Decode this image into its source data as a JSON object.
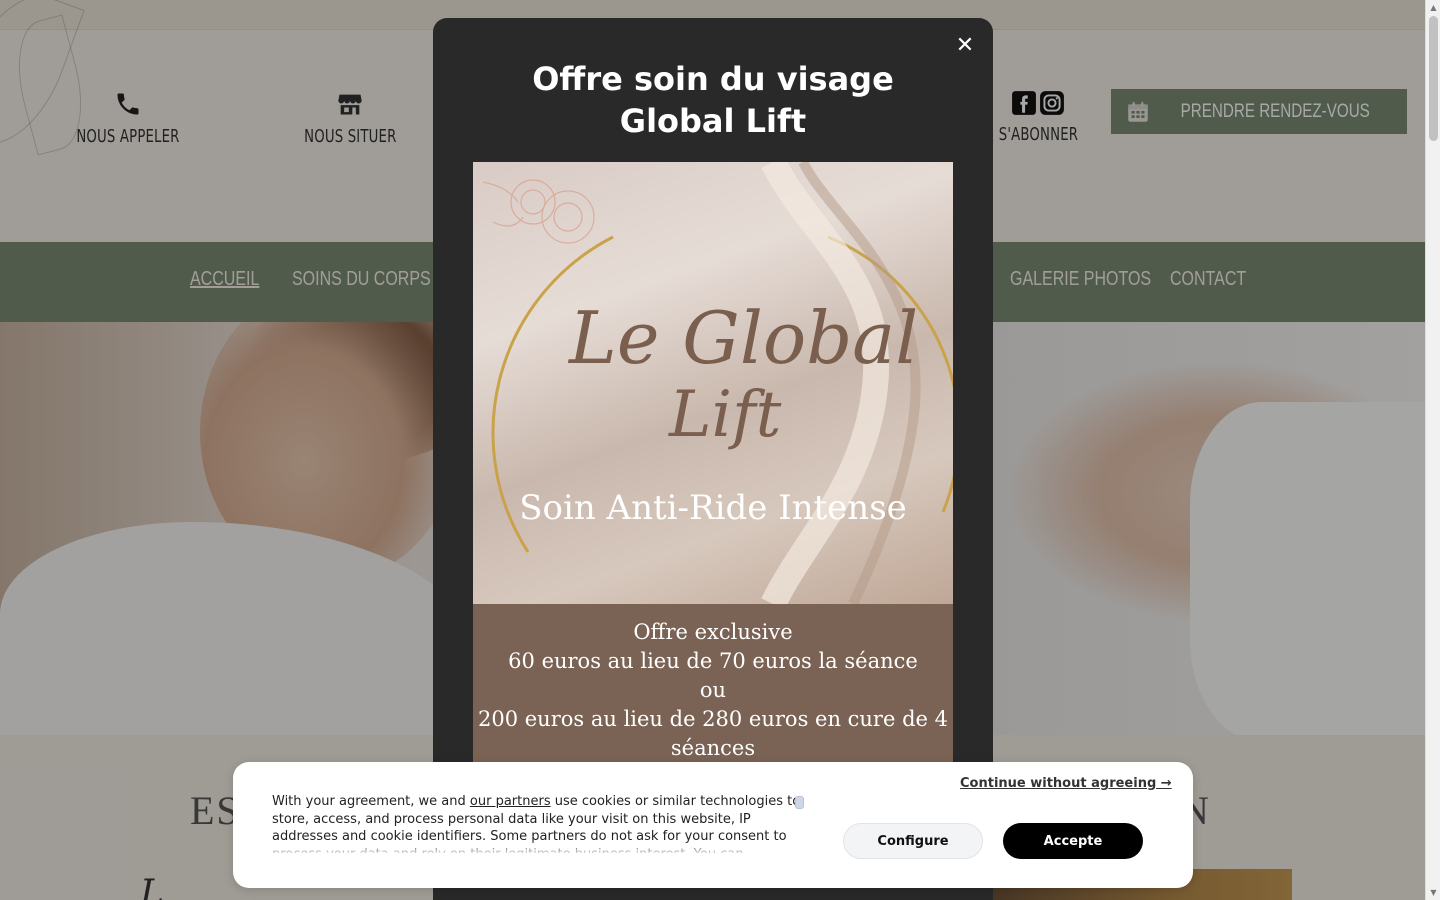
{
  "header": {
    "call_label": "NOUS APPELER",
    "locate_label": "NOUS SITUER",
    "subscribe_label": "S'ABONNER",
    "appointment_label": "PRENDRE RENDEZ-VOUS"
  },
  "nav": {
    "items": [
      {
        "label": "ACCUEIL",
        "active": true
      },
      {
        "label": "SOINS DU CORPS",
        "active": false
      },
      {
        "label": "GALERIE PHOTOS",
        "active": false
      },
      {
        "label": "CONTACT",
        "active": false
      }
    ]
  },
  "section": {
    "title_left": "ES",
    "title_right": "N",
    "script_text": "L"
  },
  "modal": {
    "title_line1": "Offre soin du visage",
    "title_line2": "Global Lift",
    "promo_script_line1": "Le Global",
    "promo_script_line2": "Lift",
    "promo_subtitle": "Soin Anti-Ride Intense",
    "offer_lines": [
      "Offre exclusive",
      "60 euros au lieu de 70 euros la séance",
      "ou",
      "200 euros au lieu de 280 euros en cure de 4",
      "séances"
    ],
    "close_glyph": "✕"
  },
  "cookie": {
    "text_before_link": "With your agreement, we and ",
    "link_text": "our partners",
    "text_after_link": " use cookies or similar technologies to store, access, and process personal data like your visit on this website, IP addresses and cookie identifiers. Some partners do not ask for your consent to process your data and rely on their legitimate business interest. You can",
    "continue_label": "Continue without agreeing →",
    "configure_label": "Configure",
    "accept_label": "Accepte"
  },
  "colors": {
    "nav_green": "#7b8b72",
    "modal_bg": "#292929",
    "offer_brown": "#7a6354",
    "accept_black": "#000000"
  },
  "icons": [
    "phone-icon",
    "store-icon",
    "facebook-icon",
    "instagram-icon",
    "calendar-icon",
    "close-icon"
  ]
}
